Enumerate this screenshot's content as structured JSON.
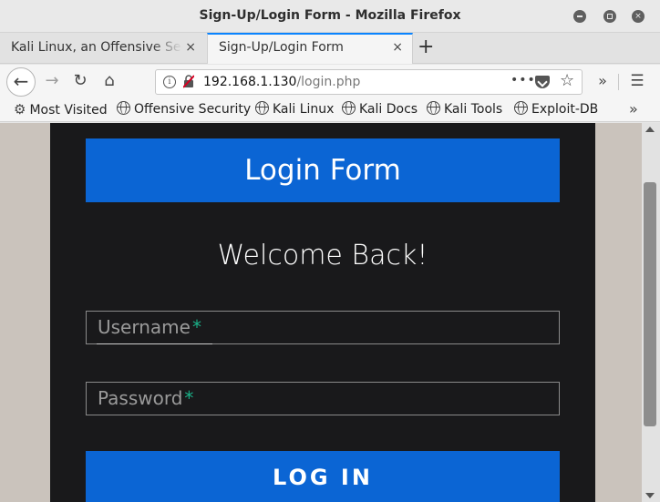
{
  "window": {
    "title": "Sign-Up/Login Form - Mozilla Firefox"
  },
  "tabs": [
    {
      "label": "Kali Linux, an Offensive Security",
      "active": false
    },
    {
      "label": "Sign-Up/Login Form",
      "active": true
    }
  ],
  "icons": {
    "tab_close": "×",
    "new_tab": "+",
    "back": "←",
    "forward": "→",
    "reload": "↻",
    "home": "⌂",
    "info": "i",
    "url_more": "•••",
    "star": "☆",
    "overflow": "»",
    "menu": "☰",
    "gear": "⚙"
  },
  "urlbar": {
    "host": "192.168.1.130",
    "path": "/login.php"
  },
  "bookmarks": [
    {
      "label": "Most Visited",
      "icon": "gear-icon"
    },
    {
      "label": "Offensive Security",
      "icon": "globe-icon"
    },
    {
      "label": "Kali Linux",
      "icon": "globe-icon"
    },
    {
      "label": "Kali Docs",
      "icon": "globe-icon"
    },
    {
      "label": "Kali Tools",
      "icon": "globe-icon"
    },
    {
      "label": "Exploit-DB",
      "icon": "globe-icon"
    }
  ],
  "page": {
    "header": "Login Form",
    "welcome": "Welcome Back!",
    "username_label": "Username",
    "password_label": "Password",
    "required_mark": "*",
    "login_button": "LOG IN"
  },
  "colors": {
    "accent_blue": "#0b65d4",
    "required_green": "#1ab188",
    "panel_bg": "#19191b",
    "page_bg": "#cac3bc"
  }
}
